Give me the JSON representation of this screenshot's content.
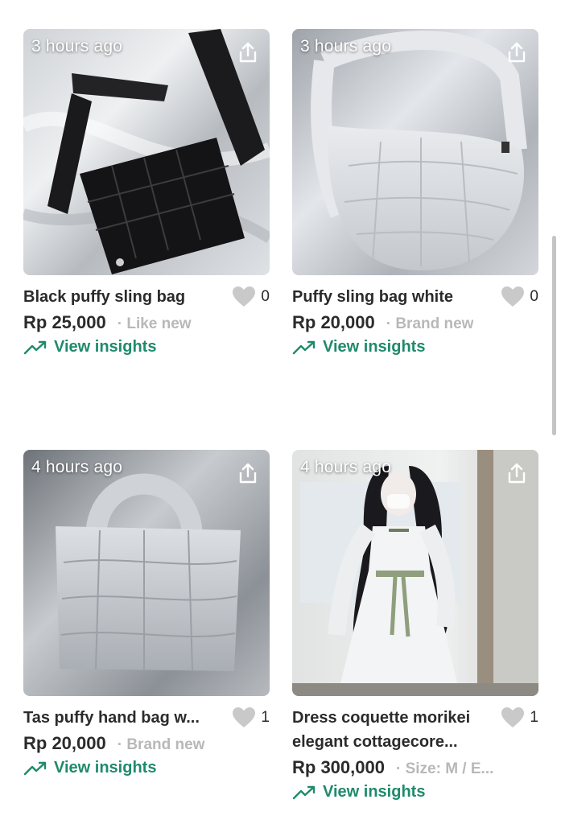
{
  "listings": [
    {
      "time_label": "3 hours ago",
      "title": "Black puffy sling bag",
      "likes": "0",
      "price": "Rp 25,000",
      "condition": "· Like new",
      "insights_label": "View insights"
    },
    {
      "time_label": "3 hours ago",
      "title": "Puffy sling bag white",
      "likes": "0",
      "price": "Rp 20,000",
      "condition": "· Brand new",
      "insights_label": "View insights"
    },
    {
      "time_label": "4 hours ago",
      "title": "Tas puffy hand bag w...",
      "likes": "1",
      "price": "Rp 20,000",
      "condition": "· Brand new",
      "insights_label": "View insights"
    },
    {
      "time_label": "4 hours ago",
      "title": "Dress coquette morikei elegant cottagecore...",
      "likes": "1",
      "price": "Rp 300,000",
      "condition": "· Size: M / E...",
      "insights_label": "View insights"
    }
  ],
  "colors": {
    "accent_green": "#1f8a6b",
    "text_dark": "#2b2b2b",
    "text_muted": "#b8b8b8",
    "heart_gray": "#c9c9c9"
  },
  "icons": [
    "share-icon",
    "heart-icon",
    "trending-up-icon"
  ]
}
